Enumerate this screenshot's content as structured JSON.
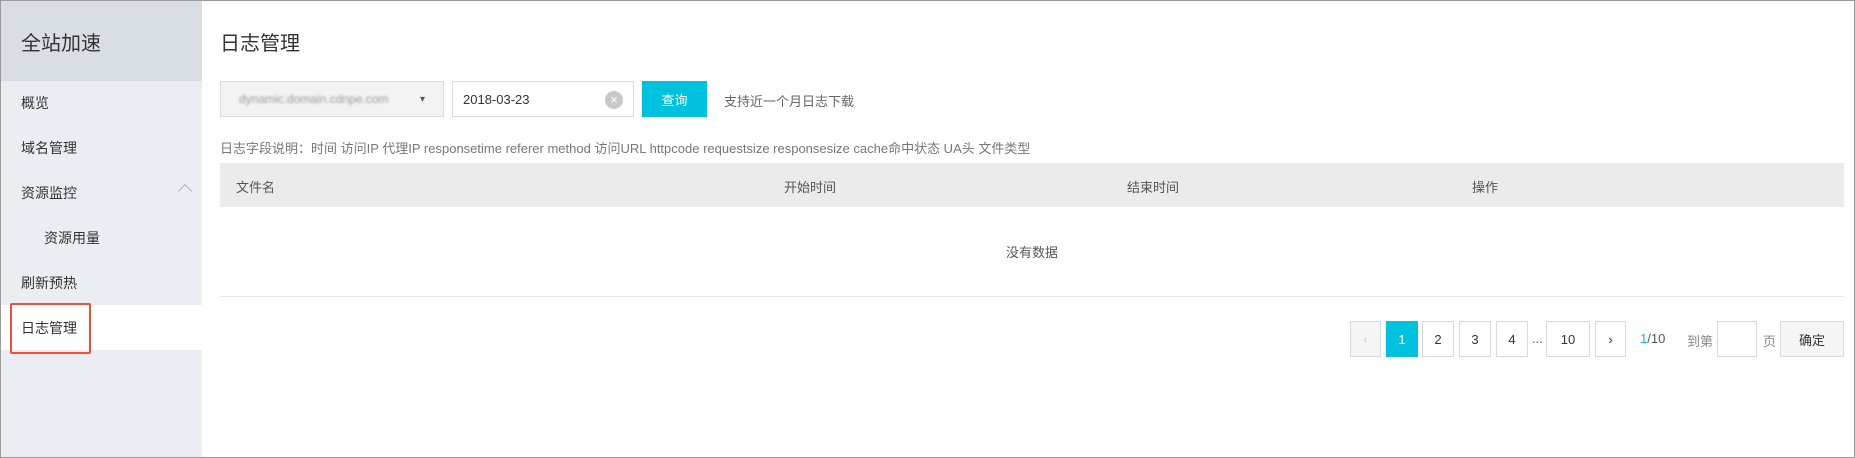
{
  "sidebar": {
    "title": "全站加速",
    "items": [
      {
        "label": "概览"
      },
      {
        "label": "域名管理"
      },
      {
        "label": "资源监控"
      },
      {
        "label": "资源用量"
      },
      {
        "label": "刷新预热"
      },
      {
        "label": "日志管理"
      }
    ]
  },
  "main": {
    "title": "日志管理",
    "domain_select": {
      "value": "dynamic.domain.cdnpe.com",
      "arrow": "▾"
    },
    "date_input": {
      "value": "2018-03-23"
    },
    "query_button": "查询",
    "hint": "支持近一个月日志下载",
    "field_description": "日志字段说明：时间 访问IP 代理IP responsetime referer method 访问URL httpcode requestsize responsesize cache命中状态 UA头 文件类型",
    "table": {
      "columns": [
        "文件名",
        "开始时间",
        "结束时间",
        "操作"
      ],
      "empty_text": "没有数据"
    }
  },
  "pagination": {
    "prev": "‹",
    "pages": [
      "1",
      "2",
      "3",
      "4"
    ],
    "ellipsis": "...",
    "last_page": "10",
    "next": "›",
    "current": "1",
    "total": "/10",
    "jump_label": "到第",
    "page_suffix": "页",
    "confirm": "确定"
  },
  "colors": {
    "accent": "#00c1de",
    "highlight": "#e8523a",
    "sidebar_bg": "#eaedf1"
  }
}
